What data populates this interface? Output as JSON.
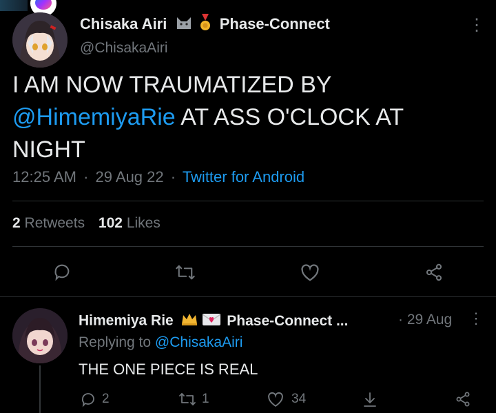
{
  "main_tweet": {
    "display_name": "Chisaka Airi",
    "affiliation": "Phase-Connect",
    "handle": "@ChisakaAiri",
    "text_before": "I AM NOW TRAUMATIZED BY",
    "mention": "@HimemiyaRie",
    "text_after_1": " AT ASS O'CLOCK AT",
    "text_after_2": "NIGHT",
    "time": "12:25 AM",
    "date": "29 Aug 22",
    "separator": "·",
    "client": "Twitter for Android",
    "retweets_count": "2",
    "retweets_label": "Retweets",
    "likes_count": "102",
    "likes_label": "Likes",
    "more_label": "⋮"
  },
  "reply": {
    "display_name": "Himemiya Rie",
    "affiliation": "Phase-Connect ...",
    "date": "· 29 Aug",
    "replying_prefix": "Replying to",
    "replying_handle": "@ChisakaAiri",
    "text": "THE ONE PIECE IS REAL",
    "reply_count": "2",
    "retweet_count": "1",
    "like_count": "34",
    "more_label": "⋮"
  },
  "colors": {
    "background": "#000000",
    "text": "#e7e9ea",
    "muted": "#71767b",
    "link": "#1d9bf0",
    "divider": "#2f3336"
  }
}
